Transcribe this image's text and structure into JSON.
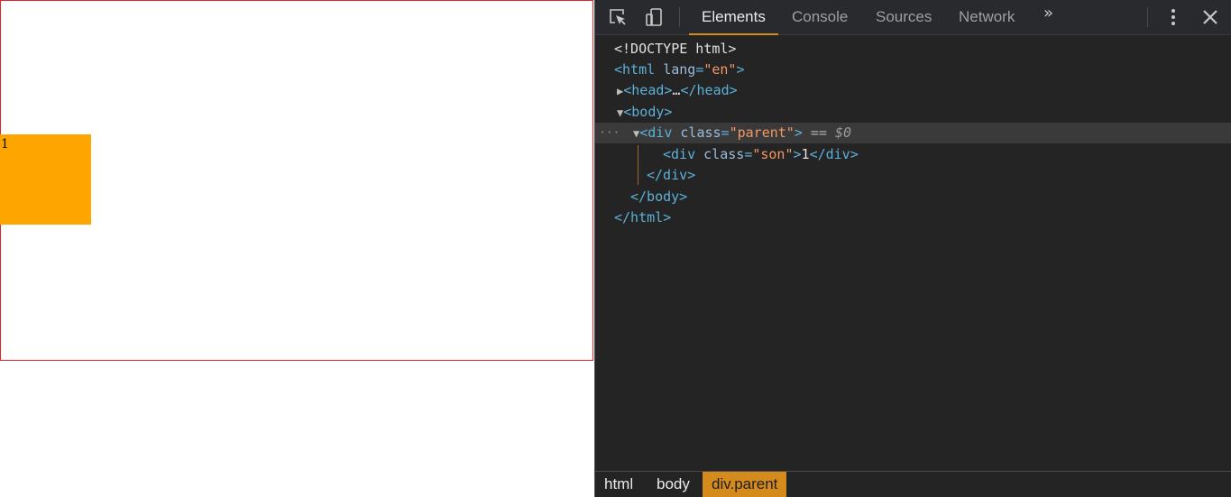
{
  "page": {
    "son_text": "1",
    "colors": {
      "parent_border": "#e0262b",
      "son_bg": "#ffa500"
    }
  },
  "devtools": {
    "toolbar": {
      "inspect_icon": "inspect-element-icon",
      "device_icon": "device-toolbar-icon",
      "tabs": [
        {
          "label": "Elements",
          "active": true
        },
        {
          "label": "Console",
          "active": false
        },
        {
          "label": "Sources",
          "active": false
        },
        {
          "label": "Network",
          "active": false
        }
      ],
      "more_tabs": "»",
      "menu_icon": "kebab-menu-icon",
      "close_icon": "close-icon"
    },
    "dom": {
      "doctype": "<!DOCTYPE html>",
      "html_open": "<html",
      "html_attr": "lang",
      "html_val": "\"en\"",
      "head_open": "<head>",
      "head_ellipsis": "…",
      "head_close": "</head>",
      "body_open": "<body>",
      "div_open": "<div",
      "attr_class": "class",
      "parent_val": "\"parent\"",
      "selected_marker": "== ",
      "selected_var": "$0",
      "son_val": "\"son\"",
      "son_text": "1",
      "div_close": "</div>",
      "body_close": "</body>",
      "html_close": "</html>"
    },
    "breadcrumbs": [
      {
        "label": "html",
        "active": false
      },
      {
        "label": "body",
        "active": false
      },
      {
        "label": "div.parent",
        "active": true
      }
    ],
    "colors": {
      "accent": "#d48b1c",
      "tag": "#5db0d7",
      "attr_value": "#f29766",
      "panel_bg": "#242424"
    }
  }
}
